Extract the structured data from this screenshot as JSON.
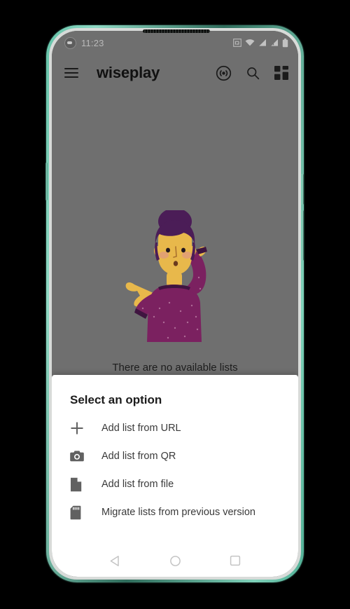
{
  "status_bar": {
    "time": "11:23",
    "left_icon": "face-badge-icon",
    "icons": [
      "nfc-icon",
      "wifi-icon",
      "signal-sim1-icon",
      "signal-sim2-icon",
      "battery-icon"
    ]
  },
  "app_bar": {
    "menu_icon": "hamburger-menu-icon",
    "title": "wiseplay",
    "actions": [
      {
        "name": "cast-icon"
      },
      {
        "name": "search-icon"
      },
      {
        "name": "grid-view-icon"
      }
    ]
  },
  "empty_state": {
    "illustration_name": "confused-woman-illustration",
    "message": "There are no available lists",
    "colors": {
      "hair": "#4b1d57",
      "sweater": "#7b2160",
      "skin": "#e8b84b",
      "background": "#6f6f6f"
    }
  },
  "bottom_sheet": {
    "title": "Select an option",
    "options": [
      {
        "icon": "plus-icon",
        "label": "Add list from URL"
      },
      {
        "icon": "camera-icon",
        "label": "Add list from QR"
      },
      {
        "icon": "file-icon",
        "label": "Add list from file"
      },
      {
        "icon": "sdcard-icon",
        "label": "Migrate lists from previous version"
      }
    ]
  },
  "nav_bar": {
    "back": "back-triangle-icon",
    "home": "home-circle-icon",
    "recents": "recents-square-icon"
  },
  "device": {
    "frame_color": "#63c2a8"
  }
}
